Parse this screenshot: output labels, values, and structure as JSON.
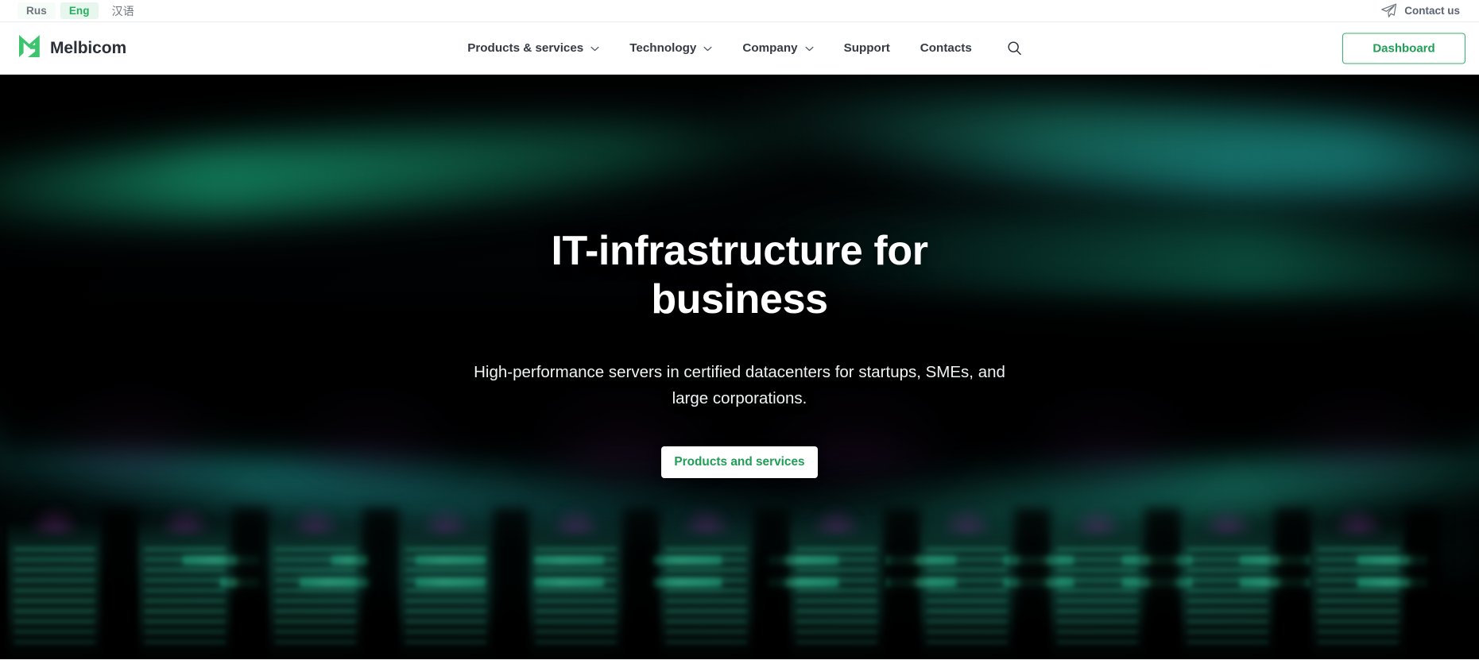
{
  "topbar": {
    "languages": [
      {
        "label": "Rus",
        "active": false
      },
      {
        "label": "Eng",
        "active": true
      },
      {
        "label": "汉语",
        "active": false
      }
    ],
    "contact_label": "Contact us",
    "contact_icon": "paper-plane-icon"
  },
  "header": {
    "brand_name": "Melbicom",
    "logo_icon": "melbicom-m-logo",
    "nav": [
      {
        "label": "Products & services",
        "has_dropdown": true
      },
      {
        "label": "Technology",
        "has_dropdown": true
      },
      {
        "label": "Company",
        "has_dropdown": true
      },
      {
        "label": "Support",
        "has_dropdown": false
      },
      {
        "label": "Contacts",
        "has_dropdown": false
      }
    ],
    "search_icon": "search-icon",
    "dashboard_label": "Dashboard"
  },
  "hero": {
    "title": "IT-infrastructure for business",
    "subtitle": "High-performance servers in certified datacenters for startups, SMEs, and large corporations.",
    "cta_label": "Products and services"
  },
  "colors": {
    "brand_green": "#27ae60",
    "button_green": "#1f9e55",
    "border_green": "#34b36a",
    "text_dark": "#2b2f38",
    "text_muted": "#6c757d",
    "hero_dark": "#05070a"
  }
}
